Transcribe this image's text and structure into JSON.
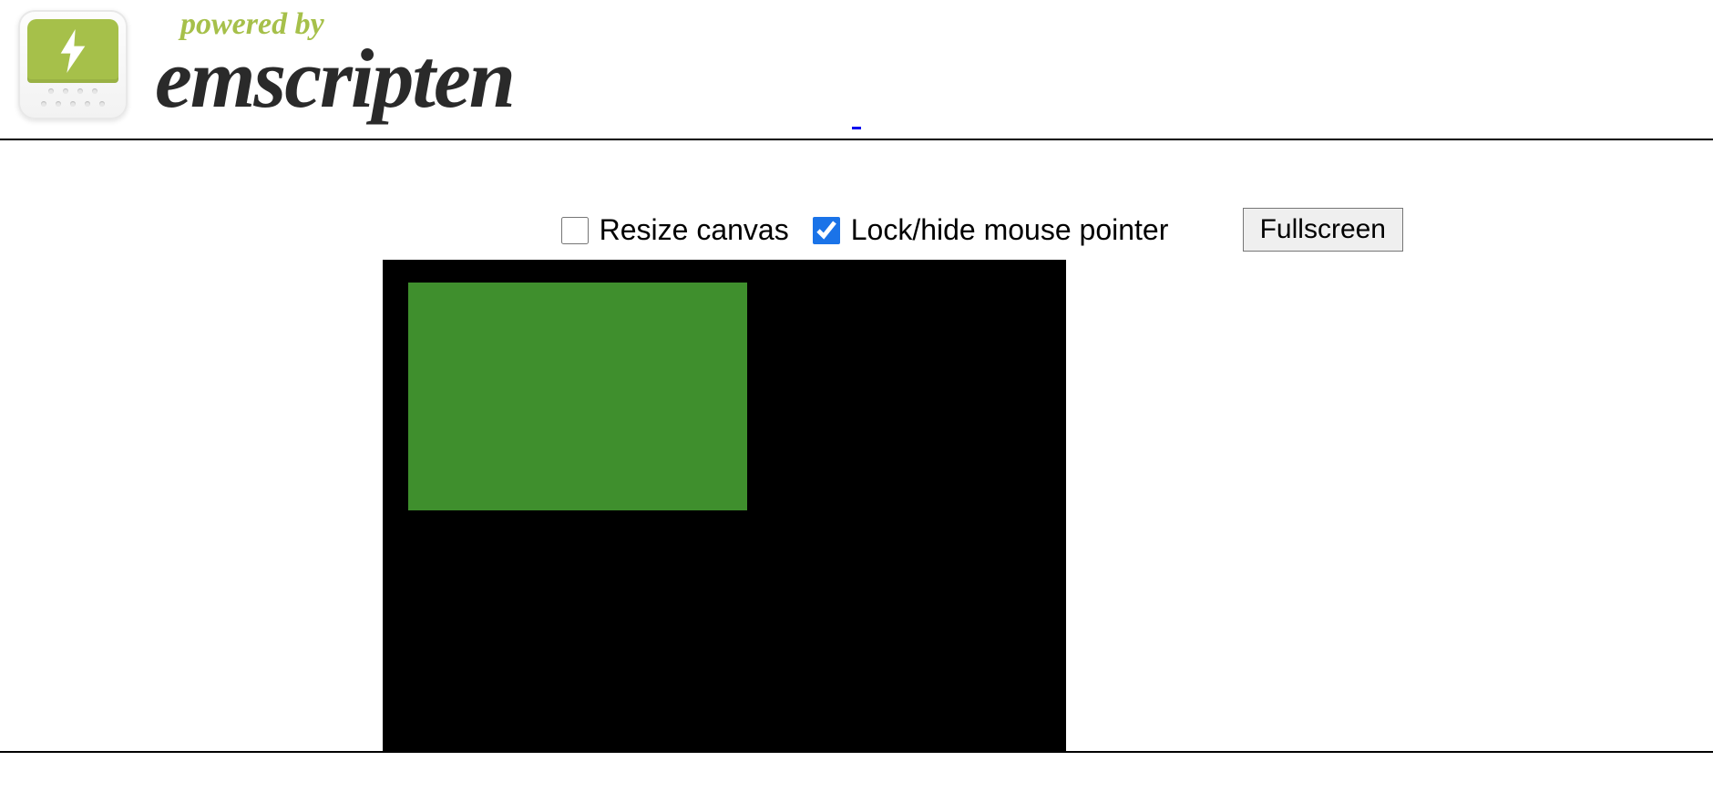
{
  "header": {
    "powered_label": "powered by",
    "brand": "emscripten",
    "icon_name": "emscripten-bolt-icon"
  },
  "controls": {
    "resize_checkbox": {
      "label": "Resize canvas",
      "checked": false
    },
    "lock_checkbox": {
      "label": "Lock/hide mouse pointer",
      "checked": true
    },
    "fullscreen_button": "Fullscreen"
  },
  "canvas": {
    "bg_color": "#000000",
    "rect_color": "#3f8f2d"
  },
  "link_placeholder": " "
}
